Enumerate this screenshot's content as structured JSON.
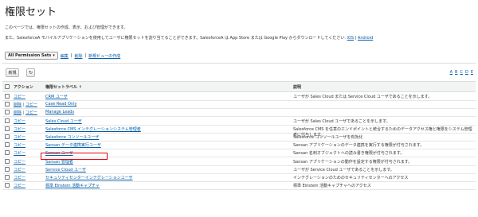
{
  "page": {
    "title": "権限セット",
    "description": "このページでは、権限セットの作成、表示、および管理ができます。",
    "mobile_note": "また、SalesforceA モバイルアプリケーションを使用してユーザに権限セットを割り当てることができます。SalesforceA は App Store または Google Play からダウンロードしてください:",
    "ios_link": "iOS",
    "android_link": "Android",
    "link_separator": "|"
  },
  "view": {
    "selected": "All Permission Sets",
    "edit_label": "編集",
    "delete_label": "削除",
    "new_view_label": "新規ビューの作成",
    "separator": "|"
  },
  "toolbar": {
    "new_label": "新規",
    "refresh_icon": "↻",
    "alphabet": [
      "A",
      "B",
      "C",
      "D",
      "E"
    ]
  },
  "table": {
    "headers": {
      "action": "アクション",
      "label": "権限セットラベル ↑",
      "description": "説明"
    },
    "rows": [
      {
        "actions": [
          "コピー"
        ],
        "label": "CRM ユーザ",
        "description": "ユーザが Sales Cloud または Service Cloud ユーザであることを示します。"
      },
      {
        "actions": [
          "削除",
          "コピー"
        ],
        "label": "Case Read Only",
        "description": ""
      },
      {
        "actions": [
          "削除",
          "コピー"
        ],
        "label": "Manage Leads",
        "description": ""
      },
      {
        "actions": [
          "コピー"
        ],
        "label": "Sales Cloud ユーザ",
        "description": "ユーザが Sales Cloud ユーザであることを示します。"
      },
      {
        "actions": [
          "コピー"
        ],
        "label": "Salesforce CMS インテグレーションシステム管理者",
        "description": "Salesforce CMS を任意のエンドポイントと統合するためのデータアクセス権と権限をシステム管理者に付与します。"
      },
      {
        "actions": [
          "コピー"
        ],
        "label": "Salesforce コンソールユーザ",
        "description": "Salesforce コンソールユーザを有効化"
      },
      {
        "actions": [
          "コピー"
        ],
        "label": "Sansan データ連携実行ユーザ",
        "description": "Sansan アプリケーションのデータ連携を実行する権限が付与されます。"
      },
      {
        "actions": [
          "コピー"
        ],
        "label": "Sansan ユーザ",
        "description": "Sansan 名刺オブジェクトへの読み書き権限が付与されます。"
      },
      {
        "actions": [
          "コピー"
        ],
        "label": "Sansan 管理者",
        "description": "Sansan アプリケーションの動作を設定する権限が付与されます。"
      },
      {
        "actions": [
          "コピー"
        ],
        "label": "Service Cloud ユーザ",
        "description": "ユーザが Service Cloud ユーザであることを示します。"
      },
      {
        "actions": [
          "コピー"
        ],
        "label": "セキュリティセンターインテグレーションユーザ",
        "description": "インテグレーションのためのセキュリティセンターへのアクセス"
      },
      {
        "actions": [
          "コピー"
        ],
        "label": "標準 Einstein 活動キャプチャ",
        "description": "標準 Einstein 活動キャプチャへのアクセス"
      }
    ]
  },
  "colors": {
    "link": "#015ba7",
    "highlight": "#e3000f"
  }
}
